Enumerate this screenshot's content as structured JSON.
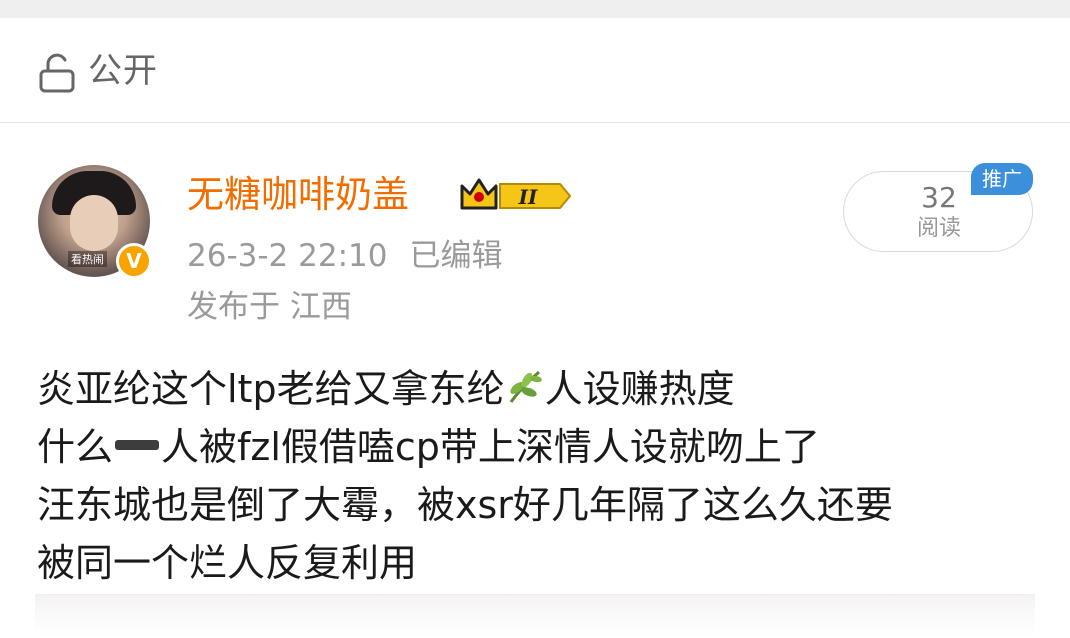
{
  "visibility": {
    "label": "公开",
    "icon": "lock-icon"
  },
  "post": {
    "author": {
      "name": "无糖咖啡奶盖",
      "avatar_caption": "看热闹",
      "verified_badge": "V",
      "vip_level": "II"
    },
    "time": "26-3-2 22:10",
    "edited": "已编辑",
    "location": "发布于 江西",
    "reads": {
      "count": "32",
      "label": "阅读"
    },
    "promo_badge": "推广",
    "lines": {
      "l1a": "炎亚纶这个ltp老给又拿东纶",
      "l1b": "人设赚热度",
      "l2a": "什么",
      "l2b": "人被fzl假借嗑cp带上深情人设就吻上了",
      "l3": "汪东城也是倒了大霉，被xsr好几年隔了这么久还要",
      "l4": "被同一个烂人反复利用"
    }
  },
  "colors": {
    "username": "#f26d00",
    "promo": "#3b8fdb",
    "vip_gold": "#f5c518",
    "meta": "#9a9a9a"
  }
}
